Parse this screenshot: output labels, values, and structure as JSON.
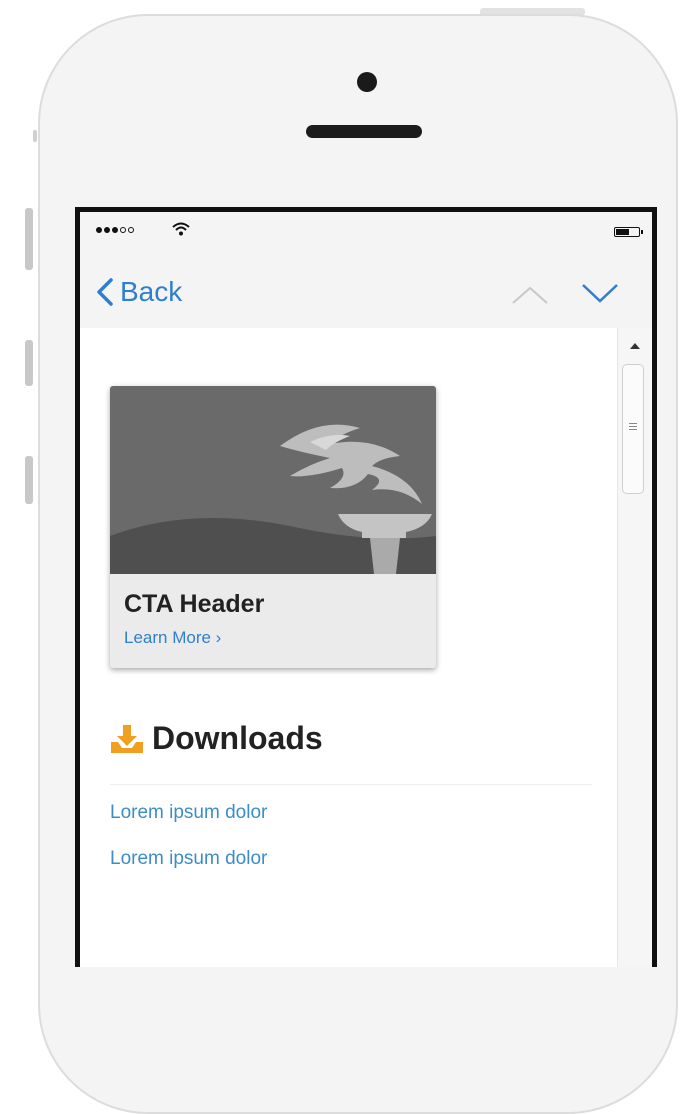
{
  "status_bar": {
    "signal_dots_filled": 3,
    "signal_dots_total": 5
  },
  "nav": {
    "back_label": "Back",
    "back_icon": "chevron-left-icon",
    "up_icon": "chevron-up-icon",
    "down_icon": "chevron-down-icon"
  },
  "cta": {
    "title": "CTA Header",
    "link": "Learn More ›",
    "image_icon": "torch-icon"
  },
  "downloads": {
    "icon": "download-icon",
    "title": "Downloads",
    "links": [
      "Lorem ipsum dolor",
      "Lorem ipsum dolor"
    ]
  },
  "colors": {
    "accent": "#2f7fd0",
    "link": "#3c8dc7",
    "download_icon": "#f0a020",
    "cta_image_bg": "#6a6a6a"
  }
}
